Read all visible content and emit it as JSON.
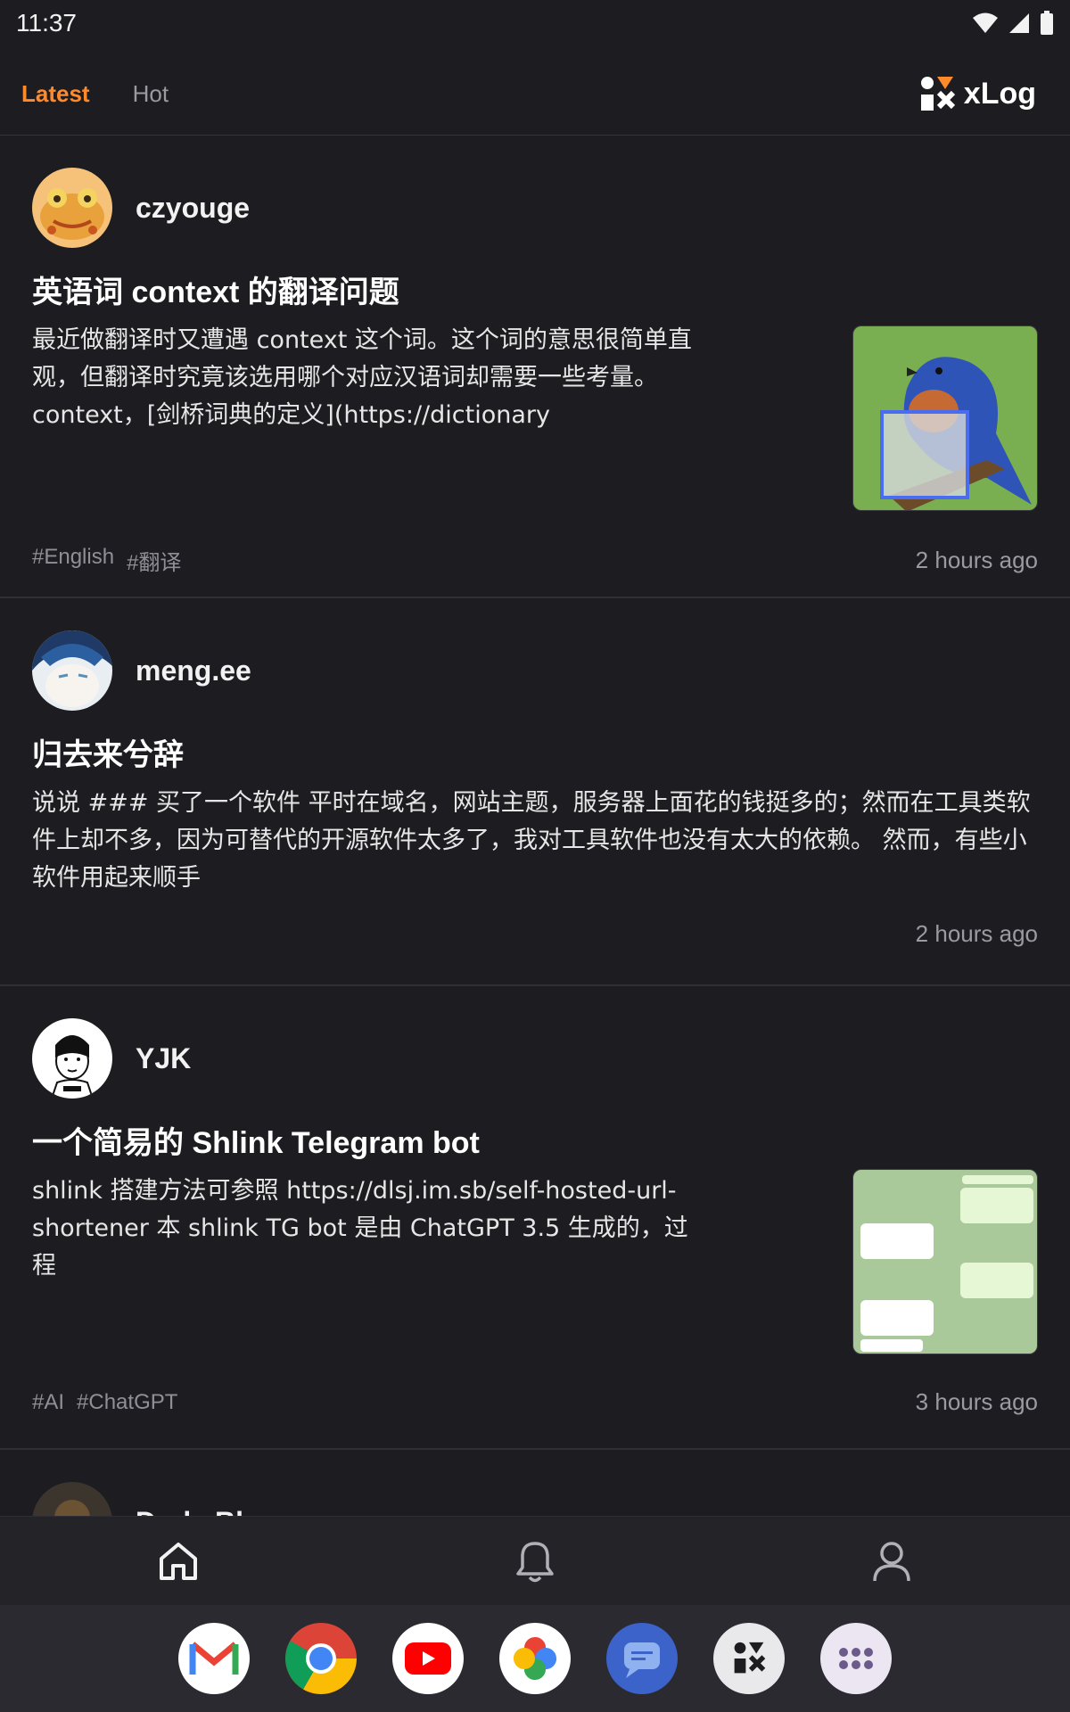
{
  "status": {
    "time": "11:37"
  },
  "header": {
    "tabs": [
      {
        "label": "Latest",
        "active": true
      },
      {
        "label": "Hot",
        "active": false
      }
    ],
    "brand": "xLog"
  },
  "posts": [
    {
      "author": "czyouge",
      "title": "英语词 context 的翻译问题",
      "excerpt": "最近做翻译时又遭遇 context 这个词。这个词的意思很简单直观，但翻译时究竟该选用哪个对应汉语词却需要一些考量。 context，[剑桥词典的定义](https://dictionary",
      "tags": [
        "#English",
        "#翻译"
      ],
      "time": "2 hours ago",
      "thumbnail": "bird-photo"
    },
    {
      "author": "meng.ee",
      "title": "归去来兮辞",
      "excerpt": "说说 ### 买了一个软件 平时在域名，网站主题，服务器上面花的钱挺多的；然而在工具类软件上却不多，因为可替代的开源软件太多了，我对工具软件也没有太大的依赖。 然而，有些小软件用起来顺手",
      "tags": [],
      "time": "2 hours ago"
    },
    {
      "author": "YJK",
      "title": "一个简易的 Shlink Telegram bot",
      "excerpt": "shlink 搭建方法可参照 https://dlsj.im.sb/self-hosted-url-shortener 本 shlink TG bot 是由 ChatGPT 3.5 生成的，过程",
      "tags": [
        "#AI",
        "#ChatGPT"
      ],
      "time": "3 hours ago",
      "thumbnail": "telegram-chat-screenshot"
    },
    {
      "author": "DarkeBl"
    }
  ],
  "bottom_nav": [
    "home-icon",
    "bell-icon",
    "profile-icon"
  ],
  "dock": [
    "gmail",
    "chrome",
    "youtube",
    "photos",
    "messages",
    "xlog",
    "app-drawer"
  ],
  "colors": {
    "accent": "#ff8a2b",
    "background": "#1d1d21"
  }
}
